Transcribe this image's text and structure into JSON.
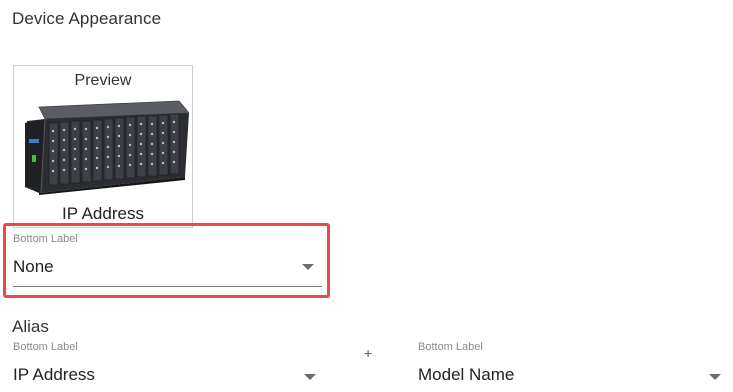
{
  "section_title": "Device Appearance",
  "preview": {
    "title": "Preview",
    "caption": "IP Address",
    "device_image_icon": "rack-switch-device-image"
  },
  "bottom_label_field": {
    "label": "Bottom Label",
    "value": "None",
    "arrow_icon": "dropdown-arrow-icon",
    "highlighted": true,
    "highlight_color": "#e8494b"
  },
  "alias": {
    "title": "Alias",
    "left_field": {
      "label": "Bottom Label",
      "value": "IP Address"
    },
    "plus": "+",
    "right_field": {
      "label": "Bottom Label",
      "value": "Model Name"
    }
  }
}
